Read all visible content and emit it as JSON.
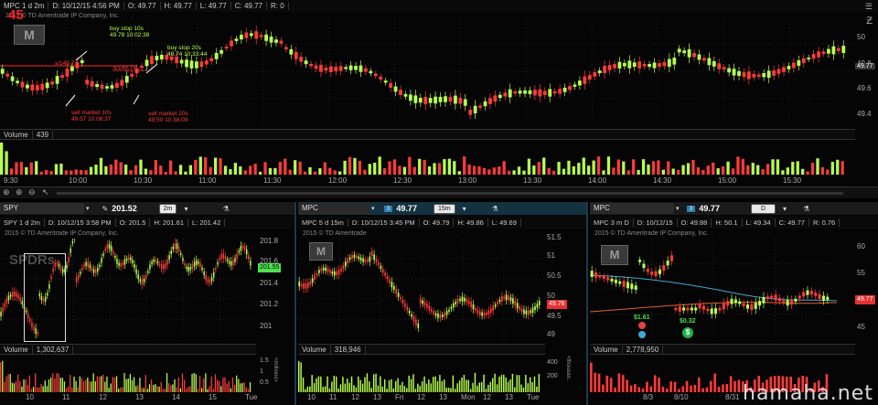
{
  "main": {
    "header": [
      "MPC 1 d 2m",
      "D: 10/12/15 4:56 PM",
      "O: 49.77",
      "H: 49.77",
      "L: 49.77",
      "C: 49.77",
      "R: 0"
    ],
    "copyright": "2015 © TD Ameritrade IP Company, Inc.",
    "red_number": "45",
    "price_label": "49.77",
    "y_ticks": [
      "50",
      "49.8",
      "49.6",
      "49.4"
    ],
    "x_ticks": [
      "9:30",
      "10:00",
      "10:30",
      "11:00",
      "11:30",
      "12:00",
      "12:30",
      "13:00",
      "13:30",
      "14:00",
      "14:30",
      "15:00",
      "15:30"
    ],
    "volume_label": "Volume",
    "volume_value": "439",
    "annotations": {
      "buy1": [
        "buy stop 10s",
        "49.78 10:02:38"
      ],
      "buy2": [
        "buy stop 20s",
        "49.74 10:33:44"
      ],
      "sell1": [
        "sell market 10s",
        "49.57 10:08:37"
      ],
      "sell2": [
        "sell market 20s",
        "49.50 10:38:09"
      ],
      "tag1": "s/149.7",
      "tag2": "s/149.74"
    }
  },
  "spy": {
    "symbol": "SPY",
    "price": "201.52",
    "timeframe": "2m",
    "header": [
      "SPY 1 d 2m",
      "D: 10/12/15 3:58 PM",
      "O: 201.5",
      "H: 201.61",
      "L: 201.42"
    ],
    "copyright": "2015 © TD Ameritrade IP Company, Inc.",
    "price_label": "201.55",
    "y_ticks": [
      "201.8",
      "201.6",
      "201.4",
      "201.2",
      "201"
    ],
    "x_ticks": [
      "10",
      "11",
      "12",
      "13",
      "14",
      "15",
      "Tue"
    ],
    "volume_label": "Volume",
    "volume_value": "1,302,637",
    "vol_unit": "<millions>",
    "vol_ticks": [
      "1.5",
      "1",
      "0.5"
    ],
    "watermark": "SPDRs"
  },
  "mpc15": {
    "symbol": "MPC",
    "price": "49.77",
    "timeframe": "15m",
    "header": [
      "MPC 5 d 15m",
      "D: 10/12/15 3:45 PM",
      "O: 49.79",
      "H: 49.86",
      "L: 49.69"
    ],
    "copyright": "2015 © TD Ameritrade",
    "price_label": "49.76",
    "y_ticks": [
      "51.5",
      "51",
      "50.5",
      "50",
      "49.5",
      "49"
    ],
    "x_ticks": [
      "10",
      "11",
      "12",
      "13",
      "Fri",
      "12",
      "13",
      "Mon",
      "12",
      "13",
      "Tue"
    ],
    "volume_label": "Volume",
    "volume_value": "318,946",
    "vol_unit": "<thousan..",
    "vol_ticks": [
      "400",
      "200"
    ]
  },
  "mpc3m": {
    "symbol": "MPC",
    "price": "49.77",
    "timeframe": "D",
    "header": [
      "MPC 3 m D",
      "D: 10/12/15",
      "O: 49.88",
      "H: 50.1",
      "L: 49.34",
      "C: 49.77",
      "R: 0.76"
    ],
    "copyright": "2015 © TD Ameritrade IP Company, Inc.",
    "price_label": "49.77",
    "y_ticks": [
      "60",
      "55",
      "50",
      "45"
    ],
    "x_ticks": [
      "8/3",
      "8/10",
      "8/31"
    ],
    "volume_label": "Volume",
    "volume_value": "2,778,950",
    "dividend_value": "$1.61",
    "dividend_value2": "$0.32"
  },
  "footer_watermark": "hamaha.net",
  "colors": {
    "up": "#b8ff52",
    "down": "#ff3a3a",
    "accent": "#3fa9d9"
  }
}
